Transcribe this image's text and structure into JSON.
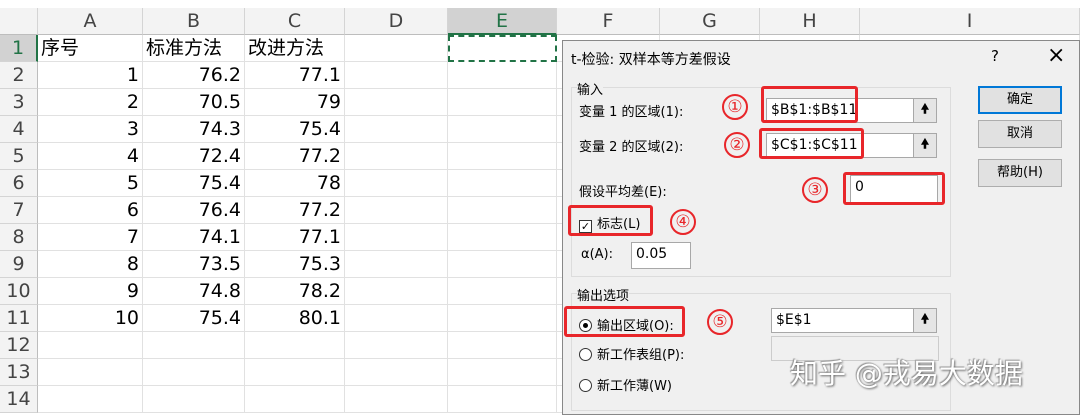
{
  "sheet": {
    "columns": [
      "A",
      "B",
      "C",
      "D",
      "E",
      "F",
      "G",
      "H",
      "I"
    ],
    "rows": [
      "1",
      "2",
      "3",
      "4",
      "5",
      "6",
      "7",
      "8",
      "9",
      "10",
      "11",
      "12",
      "13",
      "14"
    ],
    "header": [
      "序号",
      "标准方法",
      "改进方法"
    ],
    "data": [
      [
        "1",
        "76.2",
        "77.1"
      ],
      [
        "2",
        "70.5",
        "79"
      ],
      [
        "3",
        "74.3",
        "75.4"
      ],
      [
        "4",
        "72.4",
        "77.2"
      ],
      [
        "5",
        "75.4",
        "78"
      ],
      [
        "6",
        "76.4",
        "77.2"
      ],
      [
        "7",
        "74.1",
        "77.1"
      ],
      [
        "8",
        "73.5",
        "75.3"
      ],
      [
        "9",
        "74.8",
        "78.2"
      ],
      [
        "10",
        "75.4",
        "80.1"
      ]
    ]
  },
  "dialog": {
    "title": "t-检验: 双样本等方差假设",
    "help_icon": "?",
    "close_icon": "×",
    "input_group": "输入",
    "var1_label": "变量 1 的区域(1):",
    "var1_value": "$B$1:$B$11",
    "var2_label": "变量 2 的区域(2):",
    "var2_value": "$C$1:$C$11",
    "mean_diff_label": "假设平均差(E):",
    "mean_diff_value": "0",
    "labels_checkbox": "标志(L)",
    "alpha_label": "α(A):",
    "alpha_value": "0.05",
    "output_group": "输出选项",
    "output_range_label": "输出区域(O):",
    "output_range_value": "$E$1",
    "new_sheet_label": "新工作表组(P):",
    "new_workbook_label": "新工作薄(W)",
    "ok": "确定",
    "cancel": "取消",
    "help": "帮助(H)",
    "collapse_glyph": "🠝"
  },
  "annotations": [
    "①",
    "②",
    "③",
    "④",
    "⑤"
  ],
  "watermark": "知乎 @戎易大数据",
  "colors": {
    "accent": "#e8262a",
    "excel_green": "#217346"
  }
}
